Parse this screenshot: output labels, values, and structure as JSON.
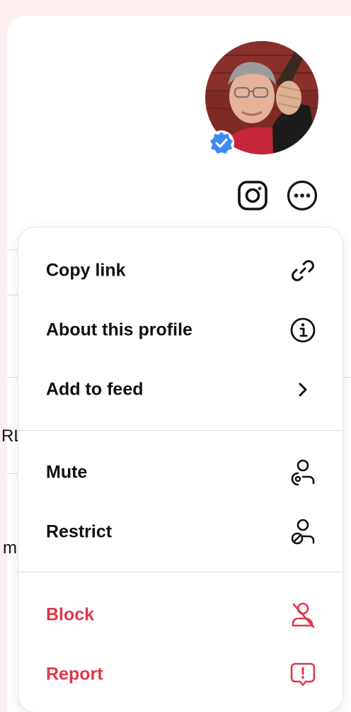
{
  "profile": {
    "verified_badge_color": "#3d8bf2"
  },
  "background_fragments": {
    "left_a": "RL",
    "left_b": "m"
  },
  "menu": {
    "danger_color": "#e0384a",
    "group1": [
      {
        "label": "Copy link",
        "icon": "link-icon"
      },
      {
        "label": "About this profile",
        "icon": "info-icon"
      },
      {
        "label": "Add to feed",
        "icon": "chevron-right-icon"
      }
    ],
    "group2": [
      {
        "label": "Mute",
        "icon": "mute-user-icon"
      },
      {
        "label": "Restrict",
        "icon": "restrict-user-icon"
      }
    ],
    "group3": [
      {
        "label": "Block",
        "icon": "block-user-icon"
      },
      {
        "label": "Report",
        "icon": "report-icon"
      }
    ]
  }
}
